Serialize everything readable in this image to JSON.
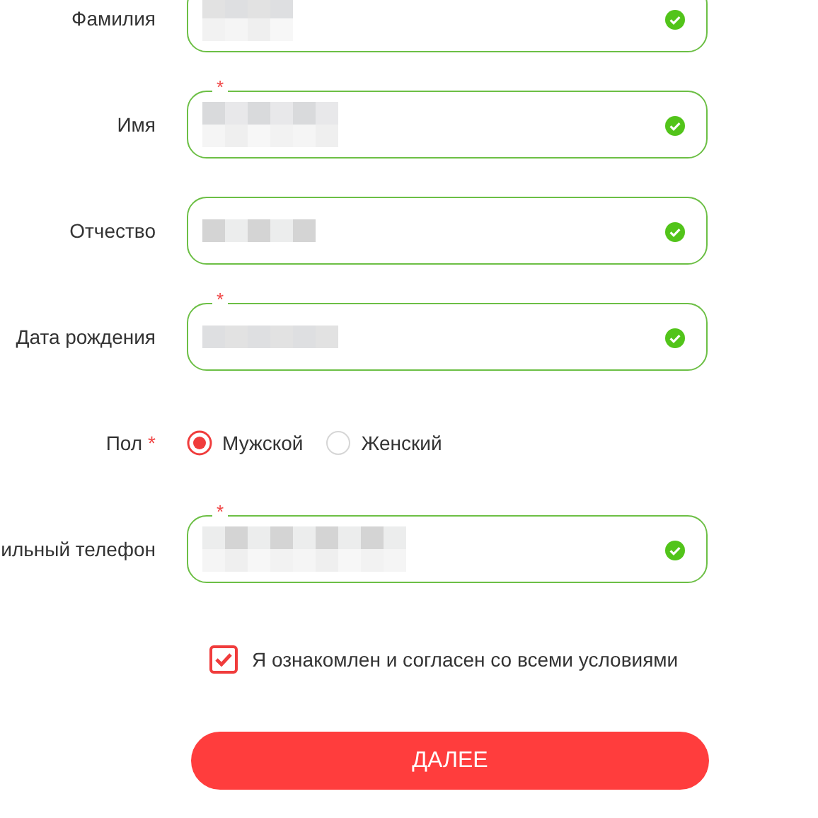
{
  "fields": [
    {
      "label": "Фамилия",
      "valid": true
    },
    {
      "label": "Имя",
      "required_mark": "*",
      "valid": true
    },
    {
      "label": "Отчество",
      "valid": true
    },
    {
      "label": "Дата рождения",
      "required_mark": "*",
      "valid": true
    },
    {
      "label": "Пол",
      "required_mark": "*",
      "kind": "radio",
      "options": [
        {
          "label": "Мужской",
          "selected": true
        },
        {
          "label": "Женский",
          "selected": false
        }
      ]
    },
    {
      "label": "ильный телефон",
      "required_mark": "*",
      "valid": true
    }
  ],
  "agreement": {
    "label": "Я ознакомлен и согласен со всеми условиями",
    "checked": true
  },
  "submit": {
    "label": "ДАЛЕЕ"
  }
}
